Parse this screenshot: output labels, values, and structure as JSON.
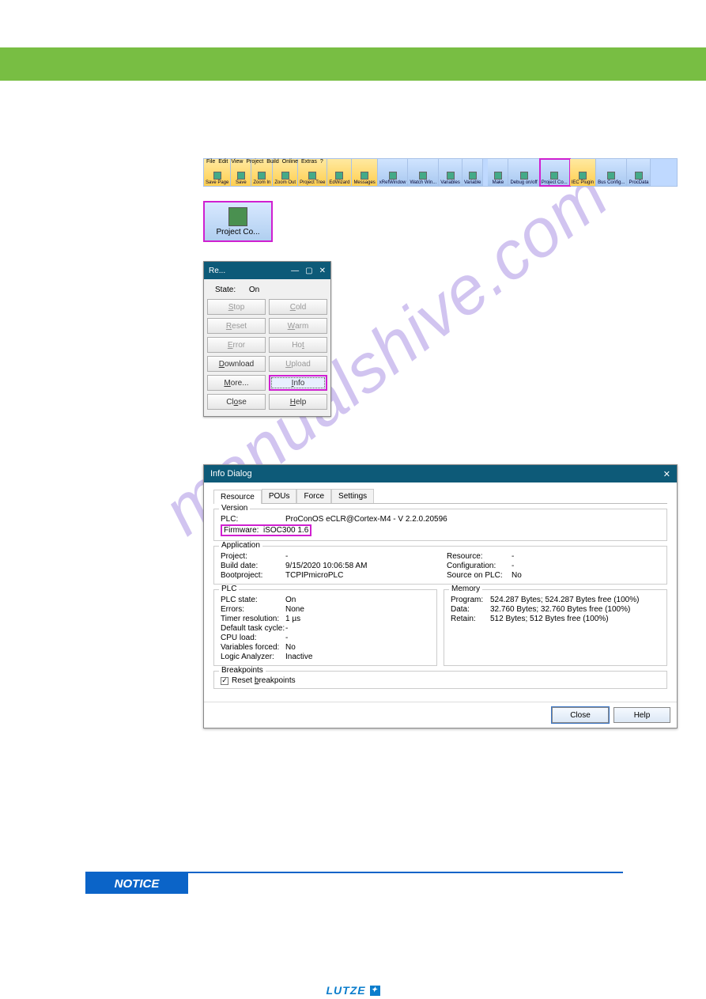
{
  "watermark": "manualshive.com",
  "menu": [
    "File",
    "Edit",
    "View",
    "Project",
    "Build",
    "Online",
    "Extras",
    "?"
  ],
  "toolbar": {
    "items": [
      {
        "label": "Save Page"
      },
      {
        "label": "Save"
      },
      {
        "label": "Zoom In"
      },
      {
        "label": "Zoom Out"
      },
      {
        "label": "Project Tree"
      },
      {
        "label": "EdWizard"
      },
      {
        "label": "Messages"
      },
      {
        "label": "xRefWindow"
      },
      {
        "label": "Watch Win..."
      },
      {
        "label": "Variables"
      },
      {
        "label": "Variable"
      },
      {
        "label": "Make"
      },
      {
        "label": "Debug on/off"
      },
      {
        "label": "Project Co..."
      },
      {
        "label": "IEC Plugin"
      },
      {
        "label": "Bus Config..."
      },
      {
        "label": "ProcData"
      }
    ],
    "highlight_index": 13
  },
  "proj_btn": {
    "label": "Project Co..."
  },
  "res_dialog": {
    "title": "Re...",
    "state_label": "State:",
    "state_value": "On",
    "buttons": {
      "stop": "Stop",
      "cold": "Cold",
      "reset": "Reset",
      "warm": "Warm",
      "error": "Error",
      "hot": "Hot",
      "download": "Download",
      "upload": "Upload",
      "more": "More...",
      "info": "Info",
      "close": "Close",
      "help": "Help"
    }
  },
  "info_dialog": {
    "title": "Info Dialog",
    "tabs": [
      "Resource",
      "POUs",
      "Force",
      "Settings"
    ],
    "version": {
      "heading": "Version",
      "plc_k": "PLC:",
      "plc_v": "ProConOS eCLR@Cortex-M4 - V 2.2.0.20596",
      "fw_k": "Firmware:",
      "fw_v": "iSOC300 1.6"
    },
    "application": {
      "heading": "Application",
      "project_k": "Project:",
      "project_v": "-",
      "build_k": "Build date:",
      "build_v": "9/15/2020 10:06:58 AM",
      "boot_k": "Bootproject:",
      "boot_v": "TCPIPmicroPLC",
      "resource_k": "Resource:",
      "resource_v": "-",
      "config_k": "Configuration:",
      "config_v": "-",
      "source_k": "Source on PLC:",
      "source_v": "No"
    },
    "plc": {
      "heading": "PLC",
      "state_k": "PLC state:",
      "state_v": "On",
      "err_k": "Errors:",
      "err_v": "None",
      "timer_k": "Timer resolution:",
      "timer_v": "1 µs",
      "task_k": "Default task cycle:",
      "task_v": "-",
      "cpu_k": "CPU load:",
      "cpu_v": "-",
      "vf_k": "Variables forced:",
      "vf_v": "No",
      "la_k": "Logic Analyzer:",
      "la_v": "Inactive"
    },
    "memory": {
      "heading": "Memory",
      "prog_k": "Program:",
      "prog_v": "524.287 Bytes; 524.287 Bytes free (100%)",
      "data_k": "Data:",
      "data_v": "32.760 Bytes; 32.760 Bytes free (100%)",
      "retain_k": "Retain:",
      "retain_v": "512 Bytes; 512 Bytes free (100%)"
    },
    "breakpoints": {
      "heading": "Breakpoints",
      "reset_label": "Reset breakpoints"
    },
    "close_btn": "Close",
    "help_btn": "Help"
  },
  "notice": {
    "label": "NOTICE"
  },
  "brand": "LUTZE"
}
